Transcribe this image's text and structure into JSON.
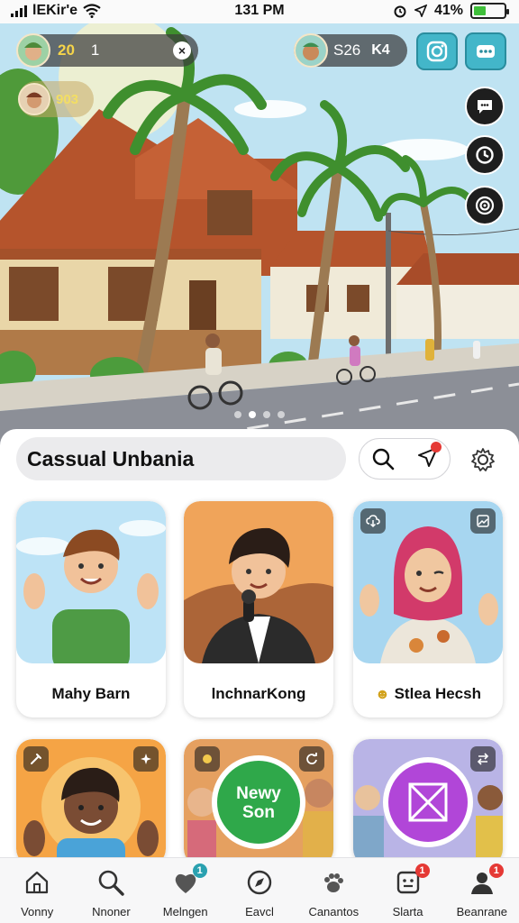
{
  "status_bar": {
    "carrier": "lEKir'e",
    "time": "131 PM",
    "battery": "41%",
    "battery_level": 0.41,
    "icons": [
      "signal-icon",
      "wifi-icon",
      "alarm-icon",
      "location-arrow-icon",
      "battery-icon"
    ]
  },
  "hero": {
    "coins": "20",
    "coins_secondary": "1",
    "score": "S26",
    "score_suffix": "K4",
    "level_value": "903",
    "carousel": {
      "slides": 4,
      "active": 2
    },
    "colors": {
      "sky": "#bfe3f2",
      "roof": "#b5542c",
      "road": "#8c8f97"
    }
  },
  "sheet": {
    "search_title": "Cassual Unbania"
  },
  "cards": [
    {
      "name": "Mahy Barn",
      "badge": "",
      "bg": "#bde3f6"
    },
    {
      "name": "lnchnarKong",
      "badge": "",
      "bg": "#f0a45a"
    },
    {
      "name": "Stlea Hecsh",
      "badge": "☻",
      "bg": "#a7d6f0"
    },
    {
      "name": "",
      "badge": "",
      "bg": "#f5a445"
    },
    {
      "name": "",
      "badge": "",
      "bg": "#e5a060",
      "button_text_1": "Newy",
      "button_text_2": "Son"
    },
    {
      "name": "",
      "badge": "",
      "bg": "#b9b4e6"
    }
  ],
  "nav": {
    "items": [
      {
        "label": "Vonny",
        "icon": "home-icon",
        "badge": ""
      },
      {
        "label": "Nnoner",
        "icon": "search-icon",
        "badge": ""
      },
      {
        "label": "Melngen",
        "icon": "heart-icon",
        "badge": "1"
      },
      {
        "label": "Eavcl",
        "icon": "compass-icon",
        "badge": ""
      },
      {
        "label": "Canantos",
        "icon": "paw-icon",
        "badge": ""
      },
      {
        "label": "Slarta",
        "icon": "face-icon",
        "badge": "1"
      },
      {
        "label": "Beanrane",
        "icon": "person-icon",
        "badge": "1"
      }
    ]
  }
}
